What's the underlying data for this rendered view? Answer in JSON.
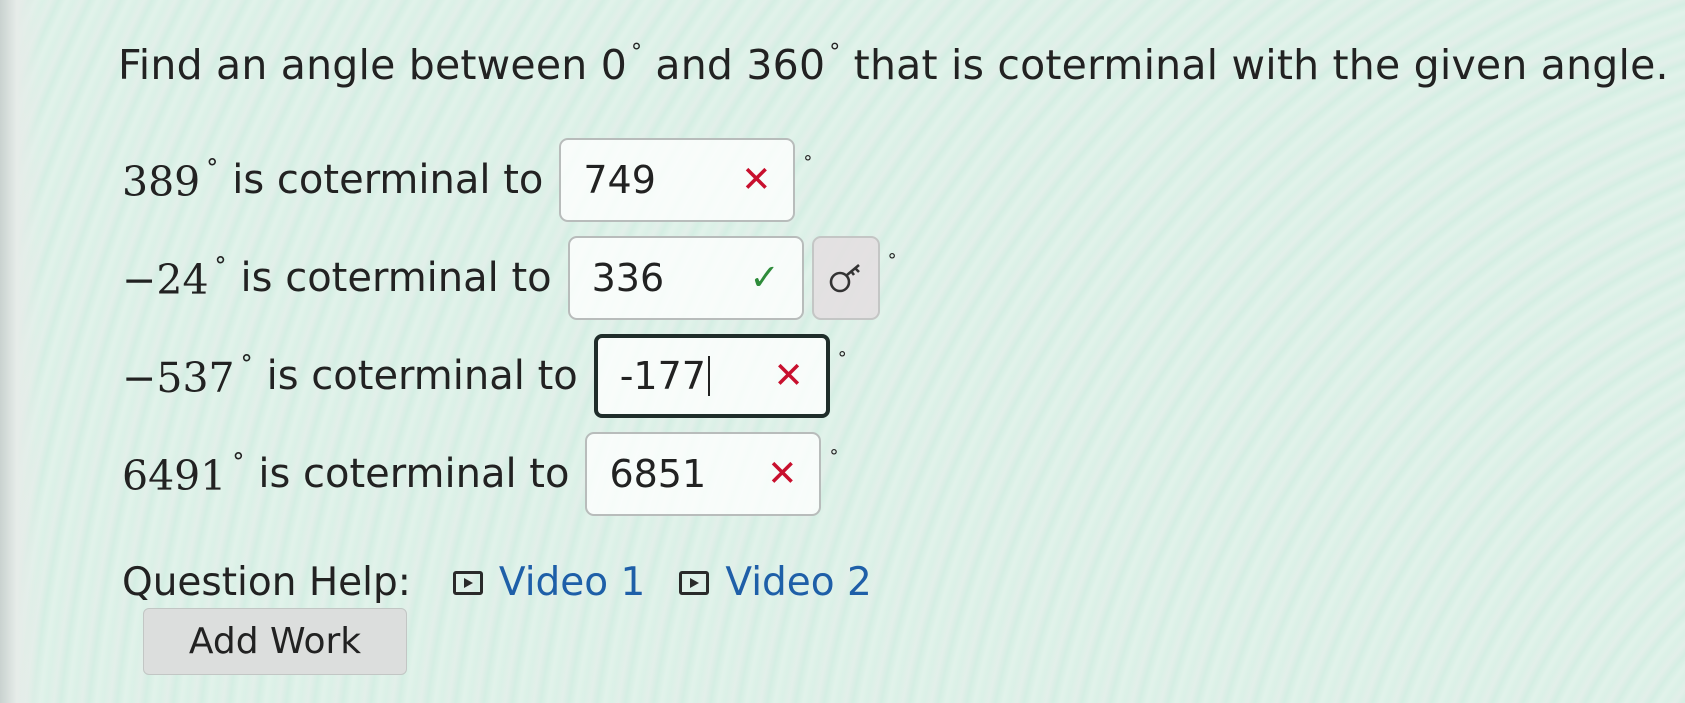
{
  "question": {
    "prefix": "Find an angle between ",
    "low": "0",
    "middle": " and ",
    "high": "360",
    "suffix": " that is coterminal with the given angle.",
    "degree": "°"
  },
  "rows": [
    {
      "angle": "389",
      "degree": "°",
      "label": "is coterminal to",
      "answer": "749",
      "status": "✕",
      "unit": "°"
    },
    {
      "angle": "−24",
      "degree": "°",
      "label": "is coterminal to",
      "answer": "336",
      "status": "✓",
      "unit": "°"
    },
    {
      "angle": "−537",
      "degree": "°",
      "label": "is coterminal to",
      "answer": "-177",
      "status": "✕",
      "unit": "°"
    },
    {
      "angle": "6491",
      "degree": "°",
      "label": "is coterminal to",
      "answer": "6851",
      "status": "✕",
      "unit": "°"
    }
  ],
  "help": {
    "label": "Question Help:",
    "video1": "Video 1",
    "video2": "Video 2"
  },
  "add_work": "Add Work",
  "icons": {
    "wrong": "x-mark-icon",
    "right": "checkmark-icon",
    "hint": "key-icon",
    "video": "play-icon"
  },
  "colors": {
    "wrong": "#c8102e",
    "right": "#2e8b3a",
    "link": "#1e5fa8"
  }
}
